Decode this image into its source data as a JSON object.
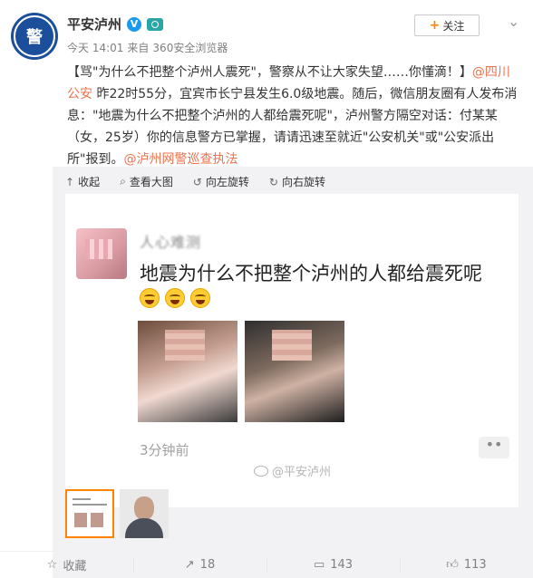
{
  "account": {
    "name": "平安泸州",
    "avatar_text": "警",
    "verified_icon": "v-verified-icon",
    "member_icon": "camera-member-icon"
  },
  "meta": {
    "time": "今天 14:01",
    "source_prefix": "来自",
    "source": "360安全浏览器"
  },
  "follow_button": {
    "label": "关注",
    "icon": "+"
  },
  "post": {
    "line1": "【骂\"为什么不把整个泸州人震死\"，警察从不让大家失望……你懂滴！】",
    "mention1": "@四川公安",
    "body": " 昨22时55分，宜宾市长宁县发生6.0级地震。随后，微信朋友圈有人发布消息：\"地震为什么不把整个泸州的人都给震死呢\"，泸州警方隔空对话：付某某（女，25岁）你的信息警方已掌握，请请迅速至就近\"公安机关\"或\"公安派出所\"报到。",
    "mention2": "@泸州网警巡查执法"
  },
  "media_toolbar": [
    {
      "label": "收起",
      "icon": "collapse-icon"
    },
    {
      "label": "查看大图",
      "icon": "zoom-icon"
    },
    {
      "label": "向左旋转",
      "icon": "rotate-left-icon"
    },
    {
      "label": "向右旋转",
      "icon": "rotate-right-icon"
    }
  ],
  "screenshot": {
    "username": "人心难测",
    "text": "地震为什么不把整个泸州的人都给震死呢",
    "time": "3分钟前",
    "more": "••"
  },
  "watermark": "@平安泸州",
  "actions": [
    {
      "label": "收藏",
      "icon": "star-icon"
    },
    {
      "label": "18",
      "icon": "share-icon"
    },
    {
      "label": "143",
      "icon": "comment-icon"
    },
    {
      "label": "113",
      "icon": "like-icon"
    }
  ],
  "colors": {
    "link": "#eb7350",
    "follow_plus": "#ff8200",
    "verified": "#1a9bf0",
    "panel_bg": "#f2f2f5"
  }
}
